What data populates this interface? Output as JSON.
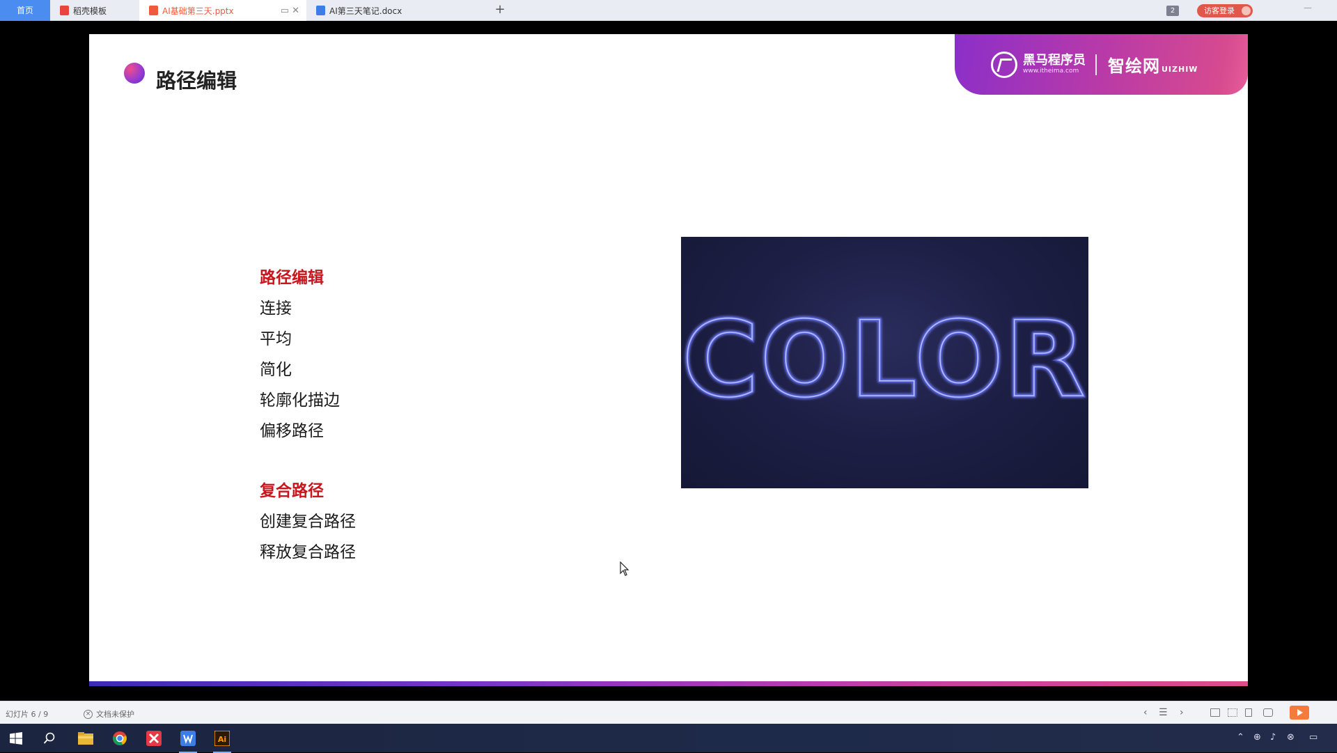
{
  "tabbar": {
    "home_label": "首页",
    "tabs": [
      {
        "label": "稻壳模板",
        "icon": "docer-icon",
        "color": "#e8453c",
        "active": false
      },
      {
        "label": "AI基础第三天.pptx",
        "icon": "pptx-icon",
        "color": "#f05a3c",
        "active": true
      },
      {
        "label": "AI第三天笔记.docx",
        "icon": "docx-icon",
        "color": "#3d7ee6",
        "active": false
      }
    ],
    "add_label": "+",
    "tab_count": "2",
    "login_label": "访客登录"
  },
  "slide": {
    "title": "路径编辑",
    "brand": {
      "name": "黑马程序员",
      "url": "www.itheima.com",
      "second": "智绘网",
      "second_suffix": "UIZHIW"
    },
    "section1": {
      "heading": "路径编辑",
      "items": [
        "连接",
        "平均",
        "简化",
        "轮廓化描边",
        "偏移路径"
      ]
    },
    "section2": {
      "heading": "复合路径",
      "items": [
        "创建复合路径",
        "释放复合路径"
      ]
    },
    "image_text": "COLOR",
    "accent_colors": {
      "heading": "#c8161d",
      "neon": "#6f7dff"
    }
  },
  "statusbar": {
    "slide_count": "幻灯片 6 / 9",
    "doc_status": "文档未保护"
  }
}
